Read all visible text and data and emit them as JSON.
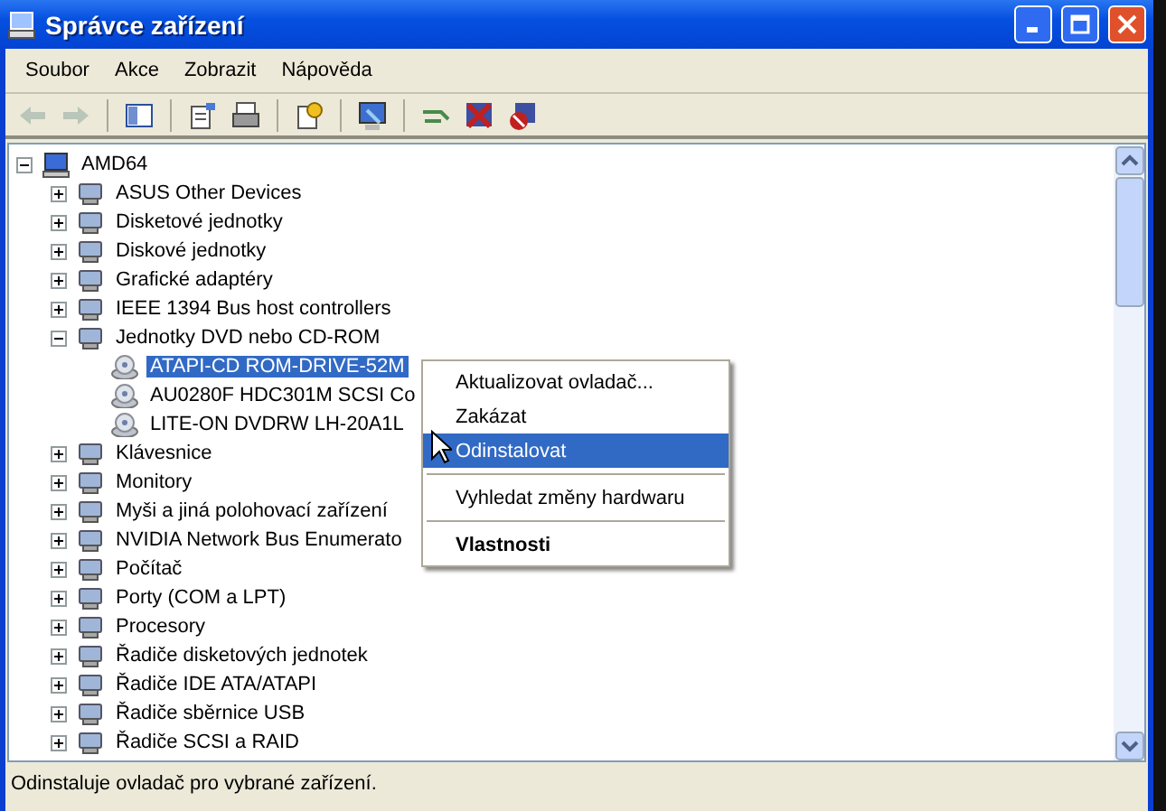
{
  "window": {
    "title": "Správce zařízení"
  },
  "menu": [
    "Soubor",
    "Akce",
    "Zobrazit",
    "Nápověda"
  ],
  "tree": {
    "label": "AMD64",
    "expanded": true,
    "selected": false,
    "children": [
      {
        "label": "ASUS Other Devices",
        "expanded": false,
        "selected": false
      },
      {
        "label": "Disketové jednotky",
        "expanded": false,
        "selected": false
      },
      {
        "label": "Diskové jednotky",
        "expanded": false,
        "selected": false
      },
      {
        "label": "Grafické adaptéry",
        "expanded": false,
        "selected": false
      },
      {
        "label": "IEEE 1394 Bus host controllers",
        "expanded": false,
        "selected": false
      },
      {
        "label": "Jednotky DVD nebo CD-ROM",
        "expanded": true,
        "selected": false,
        "children": [
          {
            "label": "ATAPI-CD ROM-DRIVE-52M",
            "selected": true
          },
          {
            "label": "AU0280F HDC301M SCSI Co",
            "selected": false
          },
          {
            "label": "LITE-ON DVDRW LH-20A1L",
            "selected": false
          }
        ]
      },
      {
        "label": "Klávesnice",
        "expanded": false,
        "selected": false
      },
      {
        "label": "Monitory",
        "expanded": false,
        "selected": false
      },
      {
        "label": "Myši a jiná polohovací zařízení",
        "expanded": false,
        "selected": false
      },
      {
        "label": "NVIDIA Network Bus Enumerato",
        "expanded": false,
        "selected": false
      },
      {
        "label": "Počítač",
        "expanded": false,
        "selected": false
      },
      {
        "label": "Porty (COM a LPT)",
        "expanded": false,
        "selected": false
      },
      {
        "label": "Procesory",
        "expanded": false,
        "selected": false
      },
      {
        "label": "Řadiče disketových jednotek",
        "expanded": false,
        "selected": false
      },
      {
        "label": "Řadiče IDE ATA/ATAPI",
        "expanded": false,
        "selected": false
      },
      {
        "label": "Řadiče sběrnice USB",
        "expanded": false,
        "selected": false
      },
      {
        "label": "Řadiče SCSI a RAID",
        "expanded": false,
        "selected": false
      }
    ]
  },
  "context_menu": [
    {
      "kind": "item",
      "label": "Aktualizovat ovladač...",
      "selected": false
    },
    {
      "kind": "item",
      "label": "Zakázat",
      "selected": false
    },
    {
      "kind": "item",
      "label": "Odinstalovat",
      "selected": true
    },
    {
      "kind": "separator"
    },
    {
      "kind": "item",
      "label": "Vyhledat změny hardwaru",
      "selected": false
    },
    {
      "kind": "separator"
    },
    {
      "kind": "default",
      "label": "Vlastnosti",
      "selected": false
    }
  ],
  "status_bar": "Odinstaluje ovladač pro vybrané zařízení."
}
